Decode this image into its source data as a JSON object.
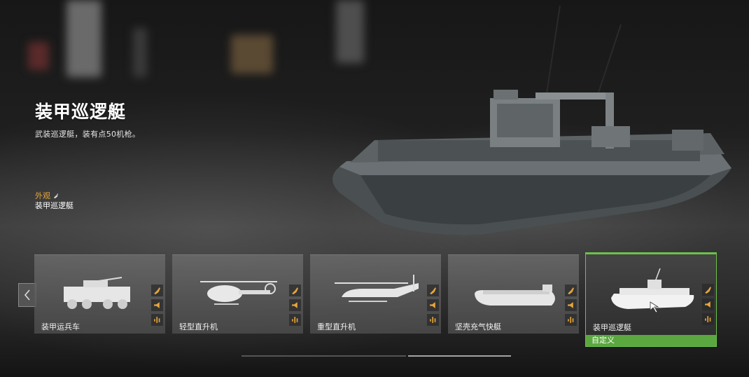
{
  "vehicle": {
    "title": "装甲巡逻艇",
    "description": "武装巡逻艇，装有点50机枪。",
    "skin_label": "外观",
    "skin_name": "装甲巡逻艇"
  },
  "carousel": {
    "cards": [
      {
        "label": "装甲运兵车",
        "thumb_icon": "apc-icon",
        "selected": false
      },
      {
        "label": "轻型直升机",
        "thumb_icon": "light-helicopter-icon",
        "selected": false
      },
      {
        "label": "重型直升机",
        "thumb_icon": "heavy-helicopter-icon",
        "selected": false
      },
      {
        "label": "坚壳充气快艇",
        "thumb_icon": "rhib-icon",
        "selected": false
      },
      {
        "label": "装甲巡逻艇",
        "thumb_icon": "armored-patrol-boat-icon",
        "selected": true,
        "badge": "自定义"
      }
    ],
    "card_icons": [
      "brush-icon",
      "horn-icon",
      "audio-icon"
    ]
  },
  "colors": {
    "accent_orange": "#e8a63a",
    "selected_green": "#5aa83f"
  }
}
